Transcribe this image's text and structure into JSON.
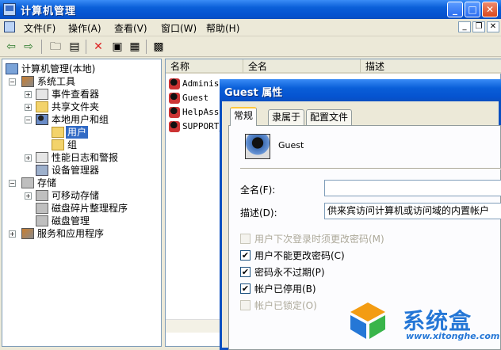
{
  "window": {
    "title": "计算机管理"
  },
  "menu": {
    "items": [
      {
        "label": "文件(F)"
      },
      {
        "label": "操作(A)"
      },
      {
        "label": "查看(V)"
      },
      {
        "label": "窗口(W)"
      },
      {
        "label": "帮助(H)"
      }
    ]
  },
  "toolbar": {
    "icons": [
      "back-icon",
      "forward-icon",
      "up-icon",
      "show-tree-icon",
      "delete-icon",
      "properties-icon",
      "export-icon",
      "help-icon"
    ]
  },
  "tree": {
    "root": "计算机管理(本地)",
    "system_tools": "系统工具",
    "event_viewer": "事件查看器",
    "shared_folders": "共享文件夹",
    "local_users_groups": "本地用户和组",
    "users": "用户",
    "groups": "组",
    "perf_logs": "性能日志和警报",
    "device_manager": "设备管理器",
    "storage": "存储",
    "removable_storage": "可移动存储",
    "defrag": "磁盘碎片整理程序",
    "disk_mgmt": "磁盘管理",
    "services_apps": "服务和应用程序"
  },
  "list": {
    "columns": [
      "名称",
      "全名",
      "描述"
    ],
    "rows": [
      {
        "name": "Administ"
      },
      {
        "name": "Guest"
      },
      {
        "name": "HelpAssi"
      },
      {
        "name": "SUPPORT_"
      }
    ]
  },
  "dialog": {
    "title": "Guest 属性",
    "tabs": [
      "常规",
      "隶属于",
      "配置文件"
    ],
    "username": "Guest",
    "fullname_label": "全名(F):",
    "fullname_value": "",
    "desc_label": "描述(D):",
    "desc_value": "供来宾访问计算机或访问域的内置帐户",
    "options": [
      {
        "label": "用户下次登录时须更改密码(M)",
        "checked": false,
        "disabled": true
      },
      {
        "label": "用户不能更改密码(C)",
        "checked": true,
        "disabled": false
      },
      {
        "label": "密码永不过期(P)",
        "checked": true,
        "disabled": false
      },
      {
        "label": "帐户已停用(B)",
        "checked": true,
        "disabled": false
      },
      {
        "label": "帐户已锁定(O)",
        "checked": false,
        "disabled": true
      }
    ]
  },
  "watermark": {
    "name": "系统盒",
    "url": "www.xitonghe.com"
  },
  "colors": {
    "titlebar": "#0553d0",
    "selection": "#316ac5",
    "watermark": "#2577d6"
  }
}
